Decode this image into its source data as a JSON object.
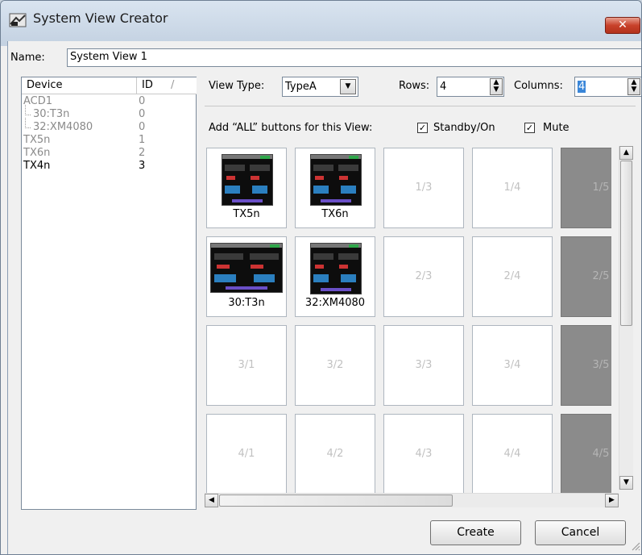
{
  "window": {
    "title": "System View Creator",
    "close_label": "✕"
  },
  "name_field": {
    "label": "Name:",
    "value": "System View 1"
  },
  "device_list": {
    "headers": {
      "device": "Device",
      "id": "ID",
      "sort_marker": "/"
    },
    "rows": [
      {
        "name": "ACD1",
        "id": "0",
        "level": 0,
        "active": false
      },
      {
        "name": "30:T3n",
        "id": "0",
        "level": 1,
        "active": false
      },
      {
        "name": "32:XM4080",
        "id": "0",
        "level": 1,
        "active": false
      },
      {
        "name": "TX5n",
        "id": "1",
        "level": 0,
        "active": false
      },
      {
        "name": "TX6n",
        "id": "2",
        "level": 0,
        "active": false
      },
      {
        "name": "TX4n",
        "id": "3",
        "level": 0,
        "active": true
      }
    ]
  },
  "view_type": {
    "label": "View Type:",
    "value": "TypeA"
  },
  "rows": {
    "label": "Rows:",
    "value": "4"
  },
  "columns": {
    "label": "Columns:",
    "value": "4"
  },
  "all_buttons": {
    "label": "Add “ALL” buttons for this View:",
    "standby": {
      "label": "Standby/On",
      "checked": true
    },
    "mute": {
      "label": "Mute",
      "checked": true
    }
  },
  "grid": {
    "cells": [
      {
        "id": "1/1",
        "label": "TX5n",
        "device": "TX5n",
        "style": "filled"
      },
      {
        "id": "1/2",
        "label": "TX6n",
        "device": "TX6n",
        "style": "filled"
      },
      {
        "id": "1/3",
        "label": "1/3",
        "style": "empty"
      },
      {
        "id": "1/4",
        "label": "1/4",
        "style": "empty"
      },
      {
        "id": "1/5",
        "label": "1/5",
        "style": "dark"
      },
      {
        "id": "2/1",
        "label": "30:T3n",
        "device": "30:T3n",
        "style": "filled"
      },
      {
        "id": "2/2",
        "label": "32:XM4080",
        "device": "32:XM4080",
        "style": "filled"
      },
      {
        "id": "2/3",
        "label": "2/3",
        "style": "empty"
      },
      {
        "id": "2/4",
        "label": "2/4",
        "style": "empty"
      },
      {
        "id": "2/5",
        "label": "2/5",
        "style": "dark"
      },
      {
        "id": "3/1",
        "label": "3/1",
        "style": "empty"
      },
      {
        "id": "3/2",
        "label": "3/2",
        "style": "empty"
      },
      {
        "id": "3/3",
        "label": "3/3",
        "style": "empty"
      },
      {
        "id": "3/4",
        "label": "3/4",
        "style": "empty"
      },
      {
        "id": "3/5",
        "label": "3/5",
        "style": "dark"
      },
      {
        "id": "4/1",
        "label": "4/1",
        "style": "empty"
      },
      {
        "id": "4/2",
        "label": "4/2",
        "style": "empty"
      },
      {
        "id": "4/3",
        "label": "4/3",
        "style": "empty"
      },
      {
        "id": "4/4",
        "label": "4/4",
        "style": "empty"
      },
      {
        "id": "4/5",
        "label": "4/5",
        "style": "dark"
      }
    ]
  },
  "buttons": {
    "create": "Create",
    "cancel": "Cancel"
  },
  "icons": {
    "app": "system-view-app-icon",
    "close": "close-icon",
    "dropdown": "chevron-down-icon",
    "spin": "spin-up-down-icon",
    "checkmark": "checkmark-icon",
    "scroll_up": "arrow-up-icon",
    "scroll_down": "arrow-down-icon",
    "scroll_left": "arrow-left-icon",
    "scroll_right": "arrow-right-icon",
    "resize_grip": "resize-grip-icon"
  },
  "colors": {
    "title_bar": "#c9d6e5",
    "close_button": "#c8412a",
    "dark_cell": "#8b8b8b",
    "selection": "#3a86d8",
    "disabled_text": "#8a8a8a"
  }
}
